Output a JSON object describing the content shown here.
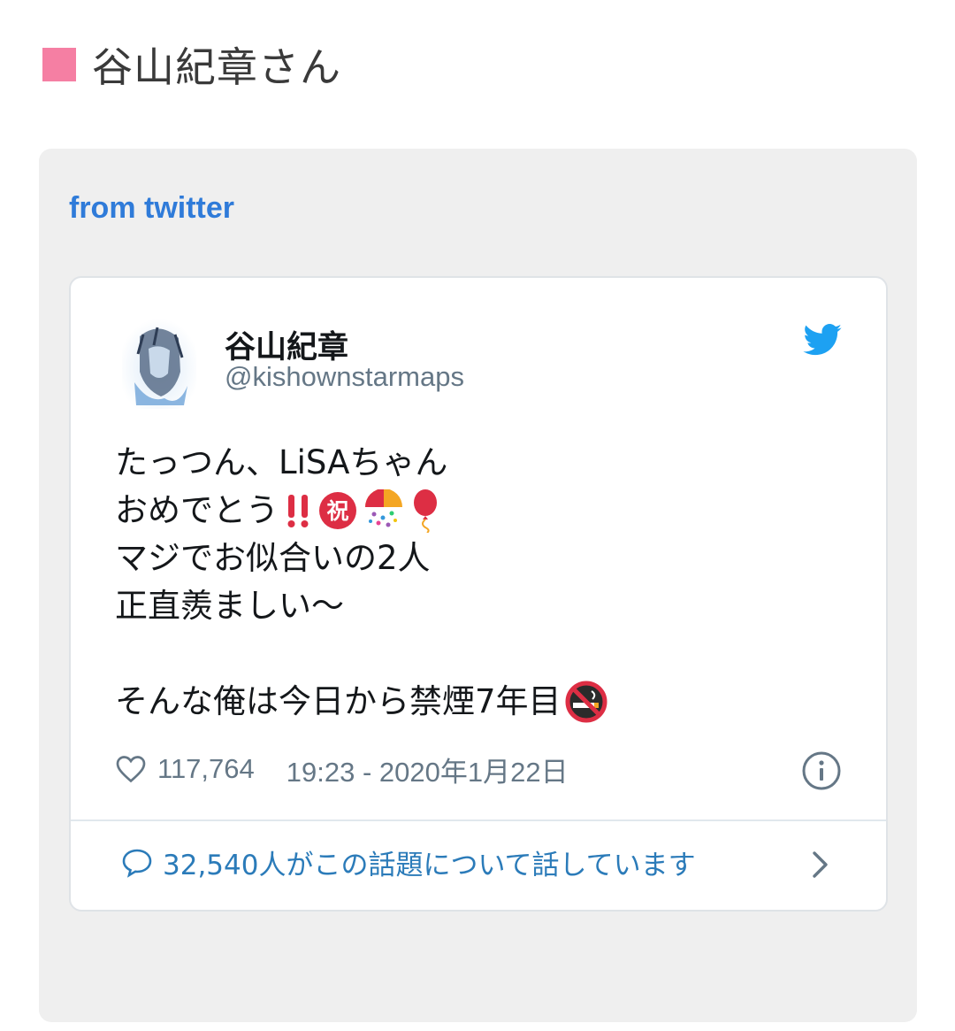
{
  "section": {
    "title": "谷山紀章さん"
  },
  "embed": {
    "source_label": "from twitter",
    "tweet": {
      "display_name": "谷山紀章",
      "handle": "@kishownstarmaps",
      "lines": [
        "たっつん、LiSAちゃん",
        "おめでとう",
        "マジでお似合いの2人",
        "正直羨ましい〜",
        "",
        "そんな俺は今日から禁煙7年目"
      ],
      "emoji_celebrate": [
        "double-exclamation",
        "congratulations-kanji",
        "confetti-ball",
        "balloon"
      ],
      "emoji_end": "no-smoking",
      "likes": "117,764",
      "timestamp": "19:23 - 2020年1月22日",
      "conversation": "32,540人がこの話題について話しています"
    }
  },
  "colors": {
    "accent_pink": "#f57fa3",
    "link_blue": "#2f7bd9",
    "twitter_blue": "#1da1f2"
  }
}
